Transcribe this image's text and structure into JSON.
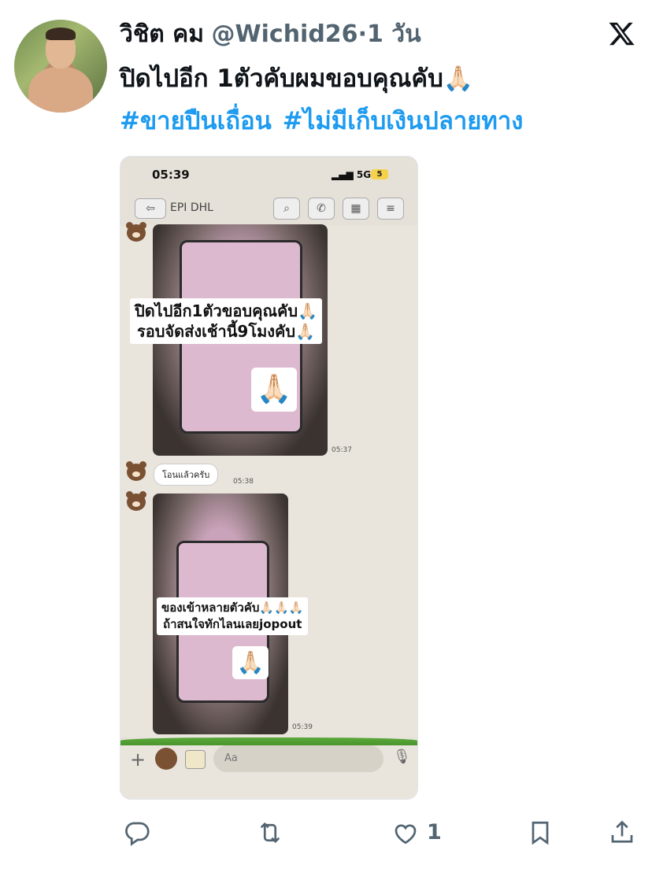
{
  "tweet": {
    "author_name": "วิชิต คม",
    "handle": "@Wichid26",
    "separator": "·",
    "time_ago": "1 วัน",
    "text": "ปิดไปอีก 1ตัวคับผมขอบคุณคับ🙏🏻",
    "hashtags": [
      "#ขายปืนเถื่อน",
      "#ไม่มีเก็บเงินปลายทาง"
    ]
  },
  "media": {
    "status_time": "05:39",
    "network": "5G",
    "battery": "5",
    "chat_name": "EPI DHL",
    "messages": [
      {
        "caption_line1": "ปิดไปอีก1ตัวขอบคุณคับ🙏🏻",
        "caption_line2": "รอบจัดส่งเช้านี้9โมงคับ🙏🏻",
        "emoji": "🙏🏻",
        "time": "05:37"
      },
      {
        "text": "โอนแล้วครับ",
        "time": "05:38"
      },
      {
        "caption_line1": "ของเข้าหลายตัวคับ🙏🏻🙏🏻🙏🏻",
        "caption_line2": "ถ้าสนใจทักไลนเลยjopout",
        "emoji": "🙏🏻",
        "time": "05:39"
      }
    ],
    "input_placeholder": "Aa"
  },
  "actions": {
    "like_count": "1"
  },
  "icons": [
    "x-logo-icon",
    "reply-icon",
    "retweet-icon",
    "like-icon",
    "bookmark-icon",
    "share-icon"
  ]
}
